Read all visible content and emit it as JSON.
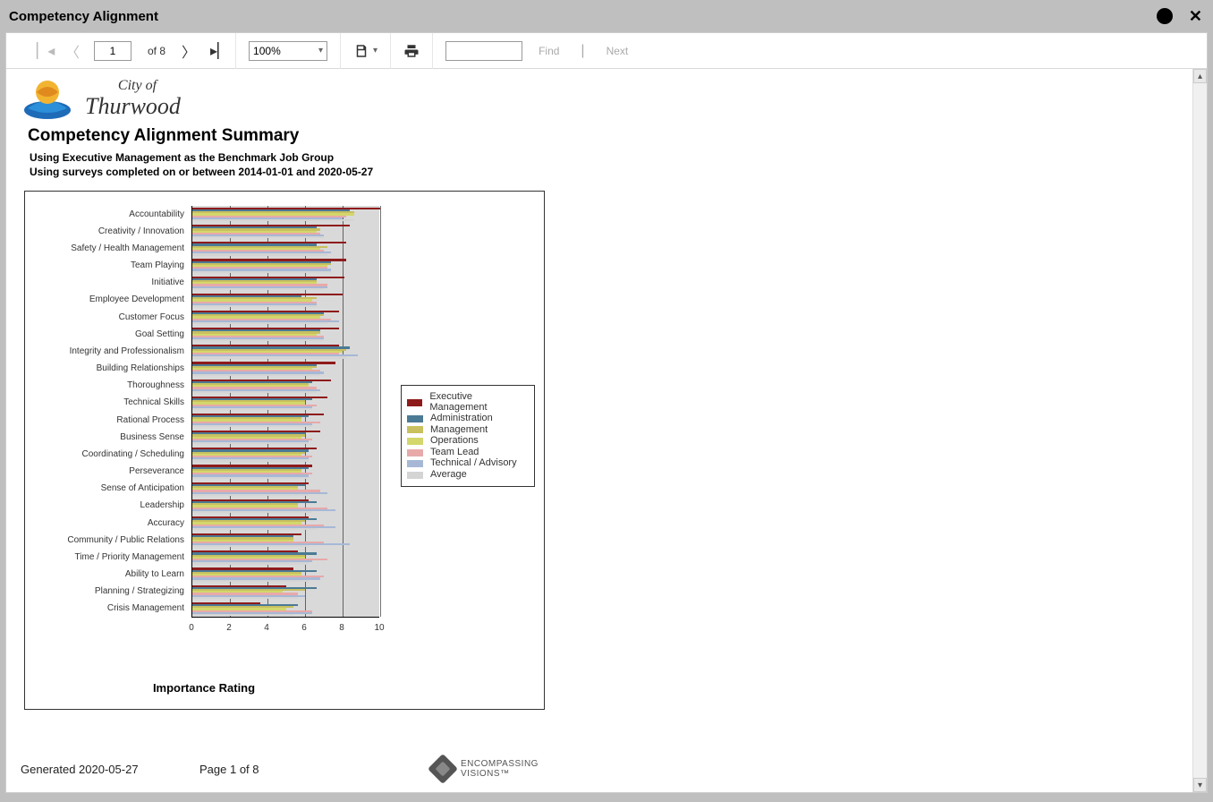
{
  "window": {
    "title": "Competency Alignment"
  },
  "toolbar": {
    "page_input": "1",
    "of_label": "of",
    "page_total": "8",
    "zoom": "100%",
    "find_placeholder": "",
    "find_label": "Find",
    "next_label": "Next"
  },
  "report": {
    "logo_line1": "City of",
    "logo_line2": "Thurwood",
    "title": "Competency Alignment Summary",
    "sub1": "Using Executive Management as the Benchmark Job Group",
    "sub2": "Using surveys completed on or between 2014-01-01 and 2020-05-27",
    "x_axis_title": "Importance Rating"
  },
  "chart_data": {
    "type": "bar",
    "orientation": "horizontal",
    "xlabel": "Importance Rating",
    "ylabel": "",
    "xlim": [
      0,
      10
    ],
    "x_ticks": [
      0,
      2,
      4,
      6,
      8,
      10
    ],
    "categories": [
      "Accountability",
      "Creativity / Innovation",
      "Safety / Health Management",
      "Team Playing",
      "Initiative",
      "Employee Development",
      "Customer Focus",
      "Goal Setting",
      "Integrity and Professionalism",
      "Building Relationships",
      "Thoroughness",
      "Technical Skills",
      "Rational Process",
      "Business Sense",
      "Coordinating / Scheduling",
      "Perseverance",
      "Sense of Anticipation",
      "Leadership",
      "Accuracy",
      "Community / Public Relations",
      "Time / Priority Management",
      "Ability to Learn",
      "Planning / Strategizing",
      "Crisis Management"
    ],
    "series": [
      {
        "name": "Executive Management",
        "color": "#8e1b1b",
        "values": [
          10.0,
          8.4,
          8.2,
          8.2,
          8.1,
          8.0,
          7.8,
          7.8,
          7.8,
          7.6,
          7.4,
          7.2,
          7.0,
          6.8,
          6.6,
          6.4,
          6.2,
          6.2,
          6.2,
          5.8,
          5.6,
          5.4,
          5.0,
          3.6
        ]
      },
      {
        "name": "Administration",
        "color": "#4b7a95",
        "values": [
          8.4,
          6.6,
          6.6,
          7.4,
          6.6,
          5.8,
          7.0,
          6.8,
          8.4,
          6.6,
          6.4,
          6.4,
          6.2,
          6.0,
          6.2,
          6.2,
          6.0,
          6.6,
          6.6,
          5.4,
          6.6,
          6.6,
          6.6,
          5.6
        ]
      },
      {
        "name": "Management",
        "color": "#c9c060",
        "values": [
          8.6,
          6.8,
          7.2,
          7.4,
          6.6,
          6.6,
          7.0,
          6.8,
          8.2,
          6.6,
          6.2,
          6.0,
          5.8,
          6.0,
          6.0,
          5.8,
          5.6,
          5.6,
          6.0,
          5.4,
          6.0,
          5.8,
          6.0,
          5.4
        ]
      },
      {
        "name": "Operations",
        "color": "#d4d76b",
        "values": [
          8.6,
          6.6,
          6.8,
          7.2,
          6.6,
          6.4,
          6.8,
          6.6,
          8.0,
          6.4,
          6.2,
          6.0,
          5.8,
          5.8,
          5.8,
          5.8,
          5.6,
          5.6,
          5.8,
          5.4,
          6.0,
          5.8,
          4.8,
          5.0
        ]
      },
      {
        "name": "Team Lead",
        "color": "#e8a9a9",
        "values": [
          8.2,
          6.8,
          7.0,
          7.2,
          7.2,
          6.6,
          7.4,
          7.0,
          7.8,
          6.8,
          6.6,
          6.6,
          6.8,
          6.4,
          6.4,
          6.4,
          6.8,
          7.2,
          7.0,
          7.0,
          7.2,
          7.0,
          5.6,
          6.4
        ]
      },
      {
        "name": "Technical / Advisory",
        "color": "#a7b8d6",
        "values": [
          8.0,
          7.0,
          7.4,
          7.4,
          7.2,
          6.6,
          7.8,
          7.0,
          8.8,
          7.0,
          6.8,
          6.4,
          6.4,
          6.2,
          6.2,
          6.2,
          7.2,
          7.6,
          7.6,
          8.4,
          6.4,
          6.8,
          6.0,
          6.4
        ]
      },
      {
        "name": "Average",
        "color": "#d4d4d4",
        "values": [
          8.6,
          7.0,
          7.2,
          7.4,
          7.0,
          6.6,
          7.2,
          7.0,
          8.2,
          6.8,
          6.6,
          6.4,
          6.4,
          6.2,
          6.2,
          6.2,
          6.2,
          6.4,
          6.6,
          6.2,
          6.2,
          6.2,
          5.6,
          5.4
        ]
      }
    ]
  },
  "footer": {
    "generated": "Generated 2020-05-27",
    "page": "Page 1 of 8",
    "brand1": "ENCOMPASSING",
    "brand2": "VISIONS™"
  }
}
